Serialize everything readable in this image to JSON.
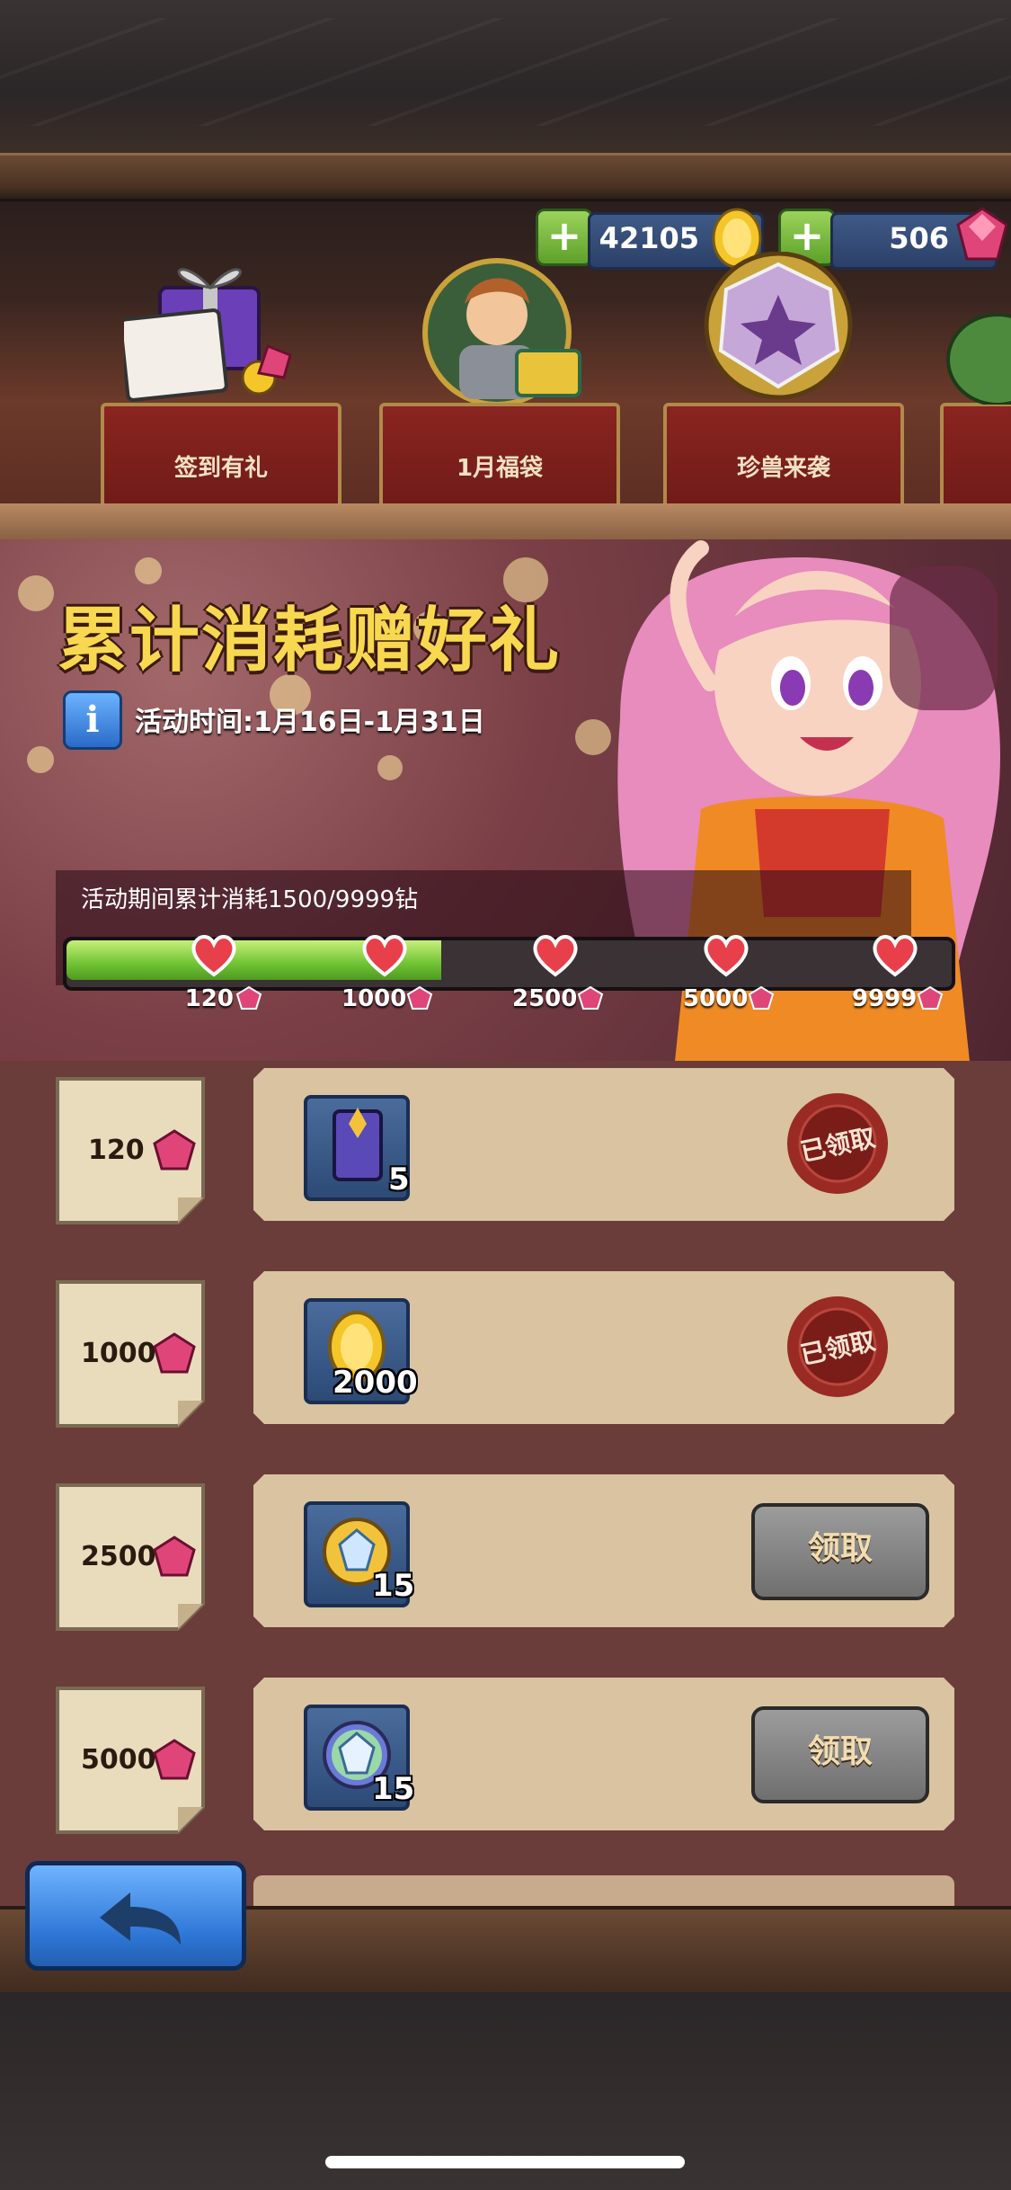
{
  "currency": {
    "gold": "42105",
    "gems": "506"
  },
  "tabs": [
    {
      "label": "签到有礼"
    },
    {
      "label": "1月福袋"
    },
    {
      "label": "珍兽来袭"
    }
  ],
  "event": {
    "title": "累计消耗赠好礼",
    "time": "活动时间:1月16日-1月31日",
    "progress_text": "活动期间累计消耗1500/9999钻",
    "progress_value": 1500,
    "progress_max": 9999,
    "milestones": [
      "120",
      "1000",
      "2500",
      "5000",
      "9999"
    ]
  },
  "rewards": [
    {
      "cost": "120",
      "item": "purple-card-pack",
      "count": "5",
      "status": "已领取"
    },
    {
      "cost": "1000",
      "item": "gold-coin",
      "count": "2000",
      "status": "已领取"
    },
    {
      "cost": "2500",
      "item": "gold-crystal-medal",
      "count": "15",
      "button": "领取"
    },
    {
      "cost": "5000",
      "item": "rainbow-crystal-medal",
      "count": "15",
      "button": "领取"
    }
  ],
  "colors": {
    "title": "#f7d850",
    "progress_fill": "#6fc233",
    "card": "#d9c3a0",
    "back_button": "#2d76d6"
  }
}
